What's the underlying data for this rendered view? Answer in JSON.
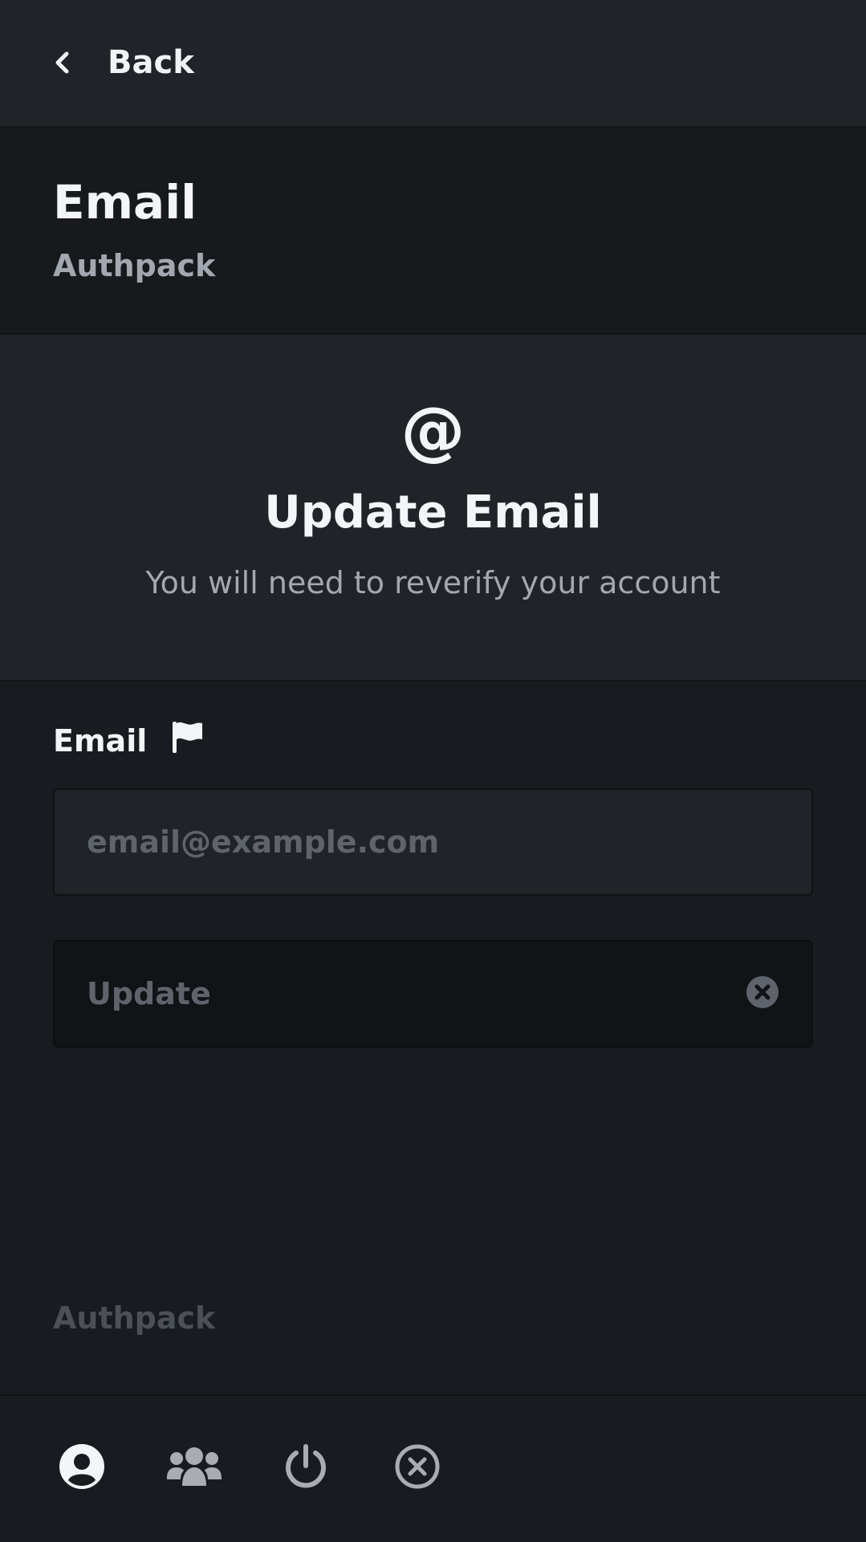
{
  "topbar": {
    "back_label": "Back"
  },
  "header": {
    "title": "Email",
    "subtitle": "Authpack"
  },
  "hero": {
    "icon_glyph": "@",
    "title": "Update Email",
    "description": "You will need to reverify your account"
  },
  "form": {
    "email_label": "Email",
    "email_placeholder": "email@example.com",
    "email_value": "",
    "submit_label": "Update"
  },
  "footer": {
    "brand": "Authpack"
  },
  "bottom_nav": {
    "items": [
      {
        "icon": "user-circle-icon",
        "active": true
      },
      {
        "icon": "users-icon",
        "active": false
      },
      {
        "icon": "power-icon",
        "active": false
      },
      {
        "icon": "close-circle-icon",
        "active": false
      }
    ]
  },
  "colors": {
    "background": "#181b1f",
    "surface": "#202328",
    "header_bg": "#17191c",
    "text_primary": "#f4f5f7",
    "text_muted": "#a3a8b0",
    "text_disabled": "#5f646c",
    "nav_inactive": "#a9adb3"
  }
}
